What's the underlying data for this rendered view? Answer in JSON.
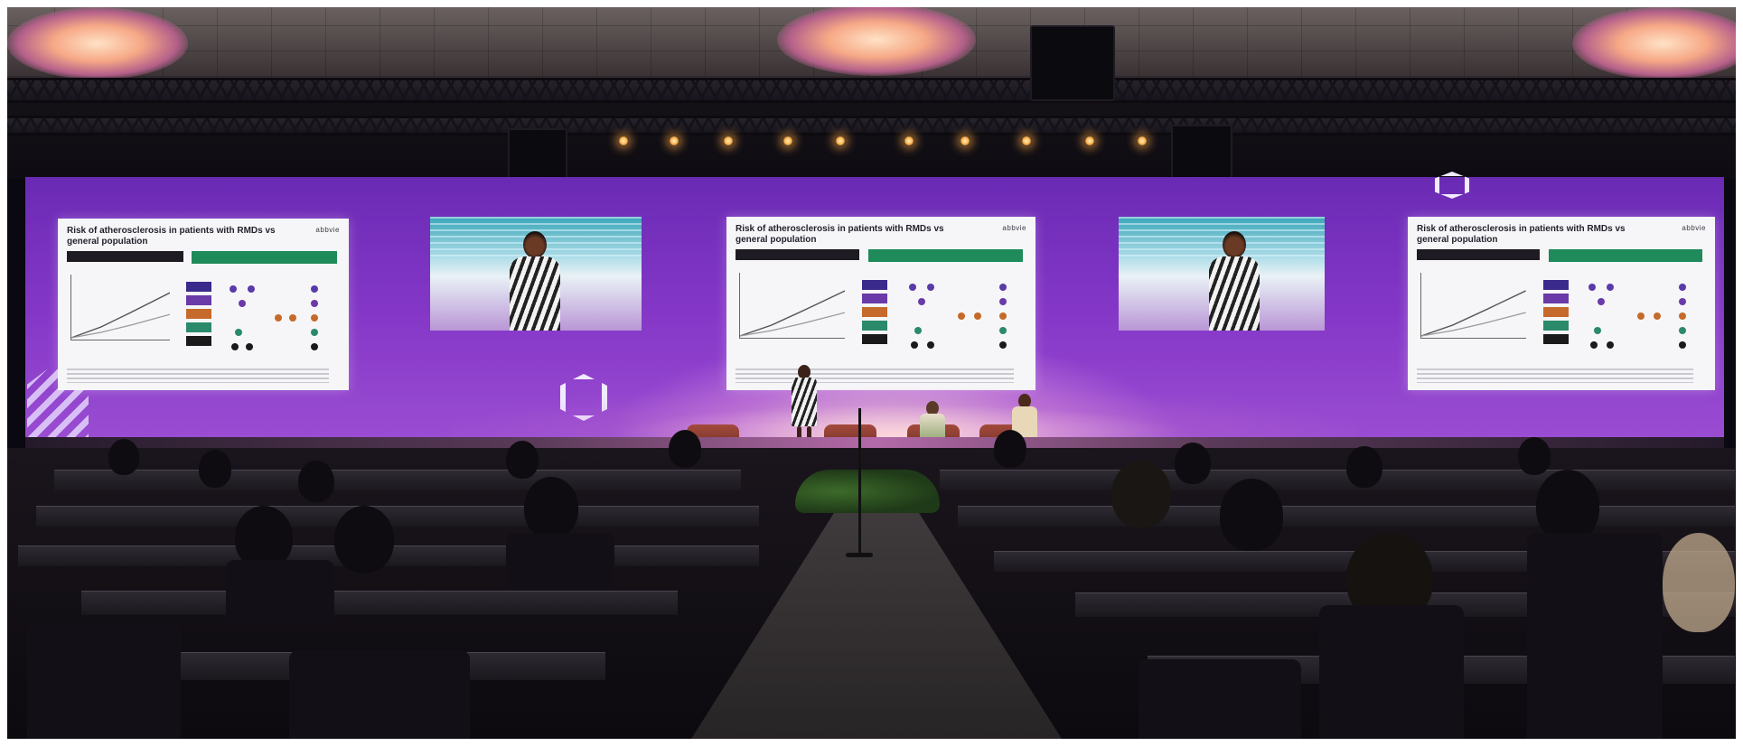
{
  "photo": {
    "description_alt": "Conference hall presentation"
  },
  "slides": {
    "left": {
      "title": "Risk of atherosclerosis in patients with RMDs vs general population",
      "brand": "abbvie"
    },
    "center": {
      "title": "Risk of atherosclerosis in patients with RMDs vs general population",
      "brand": "abbvie"
    },
    "right": {
      "title": "Risk of atherosclerosis in patients with RMDs vs general population",
      "brand": "abbvie"
    }
  },
  "colors": {
    "wall_purple": "#8638c8",
    "legend": [
      "#3a2a8c",
      "#6a3aa8",
      "#c56a2a",
      "#2a8a6a",
      "#1a1a1a"
    ],
    "dots": [
      "#5a3aa8",
      "#c56a2a",
      "#2a8a6a",
      "#1a1a1a"
    ]
  }
}
